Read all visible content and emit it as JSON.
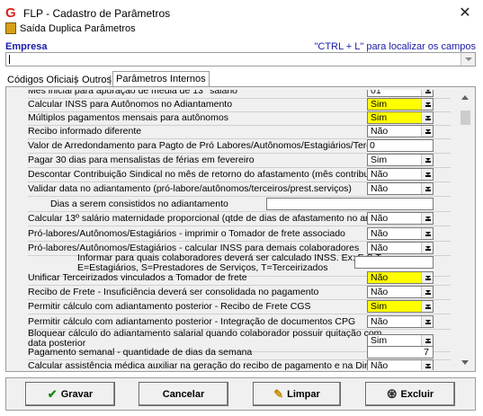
{
  "window": {
    "title": "FLP - Cadastro de Parâmetros",
    "close": "✕",
    "app_icon": "G"
  },
  "menu": {
    "items": [
      "Saída",
      "Duplica Parâmetros"
    ]
  },
  "empresa": {
    "label": "Empresa",
    "hint": "\"CTRL + L\" para localizar os campos",
    "value": ""
  },
  "tabs": {
    "items": [
      "Códigos Oficiais",
      "Outros",
      "Parâmetros Internos"
    ],
    "active": "Parâmetros Internos"
  },
  "rows": [
    {
      "label": "Mês inicial para apuração de média de 13° salário",
      "type": "select",
      "value": "01",
      "highlight": false
    },
    {
      "label": "Calcular INSS para Autônomos no Adiantamento",
      "type": "select",
      "value": "Sim",
      "highlight": true
    },
    {
      "label": "Múltiplos pagamentos mensais para autônomos",
      "type": "select",
      "value": "Sim",
      "highlight": true
    },
    {
      "label": "Recibo informado diferente",
      "type": "select",
      "value": "Não",
      "highlight": false
    },
    {
      "label": "Valor de Arredondamento para Pagto de Pró Labores/Autônomos/Estagiários/Terceiros",
      "type": "text",
      "value": "0"
    },
    {
      "label": "Pagar 30 dias para mensalistas de férias em fevereiro",
      "type": "select",
      "value": "Sim",
      "highlight": false
    },
    {
      "label": "Descontar Contribuição Sindical no mês de retorno do afastamento (mês contribuição sind.)",
      "type": "select",
      "value": "Não",
      "highlight": false
    },
    {
      "label": "Validar data no adiantamento (pró-labore/autônomos/terceiros/prest.serviços)",
      "type": "select",
      "value": "Não",
      "highlight": false
    },
    {
      "label": "Dias a serem consistidos no adiantamento",
      "type": "text-wide",
      "value": ""
    },
    {
      "label": "Calcular 13º salário maternidade proporcional (qtde de dias de afastamento no ano)",
      "type": "select",
      "value": "Não",
      "highlight": false
    },
    {
      "label": "Pró-labores/Autônomos/Estagiários - imprimir o Tomador de frete associado",
      "type": "select",
      "value": "Não",
      "highlight": false
    },
    {
      "label": "Pró-labores/Autônomos/Estagiários - calcular INSS para demais colaboradores",
      "type": "select",
      "value": "Não",
      "highlight": false
    },
    {
      "label": "Informar para quais colaboradores deverá ser calculado INSS. Ex: E,S,T E=Estagiários, S=Prestadores de Serviços, T=Terceirizados",
      "type": "text-partial",
      "value": ""
    },
    {
      "label": "Unificar Terceirizados vinculados a Tomador de frete",
      "type": "select",
      "value": "Não",
      "highlight": true
    },
    {
      "label": "Recibo de Frete - Insuficiência deverá ser consolidada no pagamento",
      "type": "select",
      "value": "Não",
      "highlight": false
    },
    {
      "label": "Permitir cálculo com adiantamento posterior - Recibo de Frete CGS",
      "type": "select",
      "value": "Sim",
      "highlight": true
    },
    {
      "label": "Permitir cálculo com adiantamento posterior - Integração de documentos CPG",
      "type": "select",
      "value": "Não",
      "highlight": false
    },
    {
      "label": "Bloquear cálculo do adiantamento salarial quando colaborador possuir quitação com data posterior",
      "type": "select",
      "value": "Sim",
      "highlight": false
    },
    {
      "label": "Pagamento semanal - quantidade de dias da  semana",
      "type": "text-right",
      "value": "7"
    },
    {
      "label": "Calcular assistência médica auxiliar na geração do recibo de pagamento e na Dirf",
      "type": "select",
      "value": "Não",
      "highlight": false
    }
  ],
  "buttons": {
    "gravar": "Gravar",
    "cancelar": "Cancelar",
    "limpar": "Limpar",
    "excluir": "Excluir"
  },
  "colors": {
    "highlight": "#ffff00",
    "accent_blue": "#1a1aa6"
  }
}
